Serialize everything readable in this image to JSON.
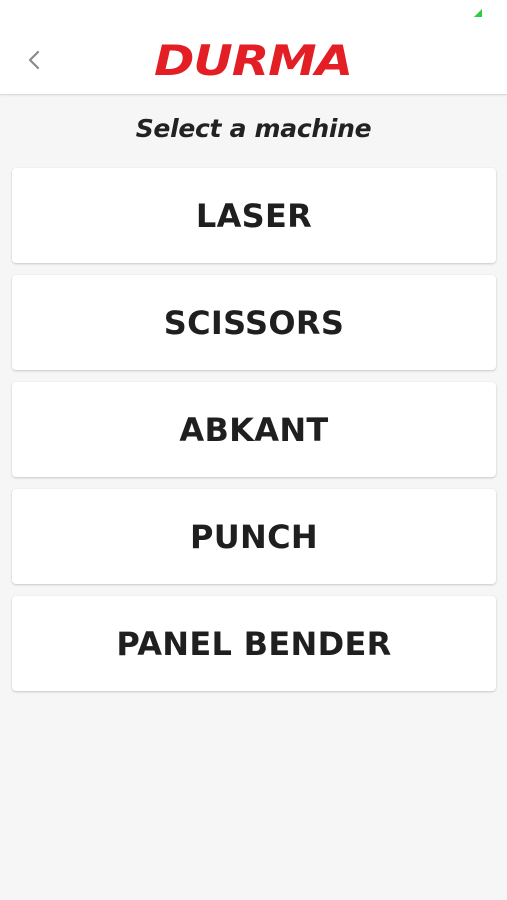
{
  "header": {
    "back_icon": "chevron-left-icon",
    "logo_text": "DURMA",
    "brand_color": "#e31e24"
  },
  "page": {
    "title": "Select a machine"
  },
  "machines": [
    {
      "label": "LASER"
    },
    {
      "label": "SCISSORS"
    },
    {
      "label": "ABKANT"
    },
    {
      "label": "PUNCH"
    },
    {
      "label": "PANEL BENDER"
    }
  ],
  "status_bar": {
    "battery_icon": "battery-icon",
    "battery_color": "#2ecc40"
  }
}
